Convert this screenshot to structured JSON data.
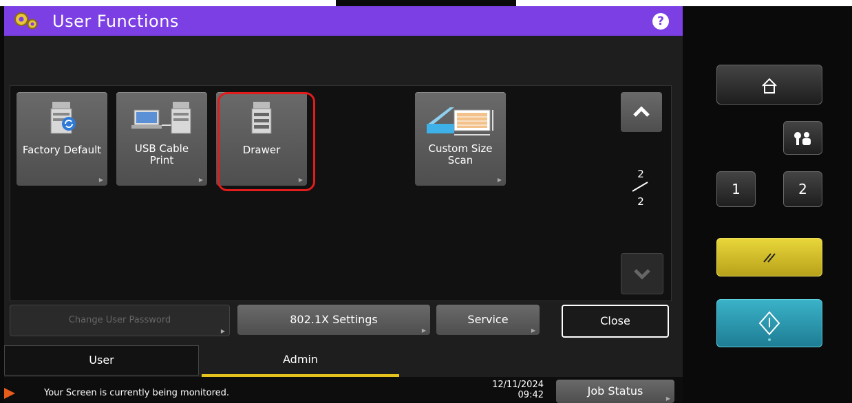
{
  "header": {
    "title": "User Functions",
    "help_label": "?"
  },
  "tiles": [
    {
      "label": "Factory Default",
      "icon": "factory-default-icon"
    },
    {
      "label": "USB Cable\nPrint",
      "icon": "usb-print-icon"
    },
    {
      "label": "Drawer",
      "icon": "drawer-icon"
    },
    {
      "label": "Custom Size\nScan",
      "icon": "custom-scan-icon"
    }
  ],
  "pagination": {
    "current": "2",
    "total": "2"
  },
  "actions": {
    "change_password": "Change User Password",
    "dot1x": "802.1X Settings",
    "service": "Service",
    "close": "Close"
  },
  "tabs": {
    "user": "User",
    "admin": "Admin"
  },
  "status": {
    "message": "Your Screen is currently being monitored.",
    "date": "12/11/2024",
    "time": "09:42",
    "job_status": "Job Status"
  },
  "hardware": {
    "key1": "1",
    "key2": "2"
  },
  "colors": {
    "header": "#7b3fe4",
    "active_tab": "#e6c21d",
    "highlight": "#e21b1b",
    "reset_key": "#d8c12a",
    "start_key": "#2e9bb0"
  }
}
